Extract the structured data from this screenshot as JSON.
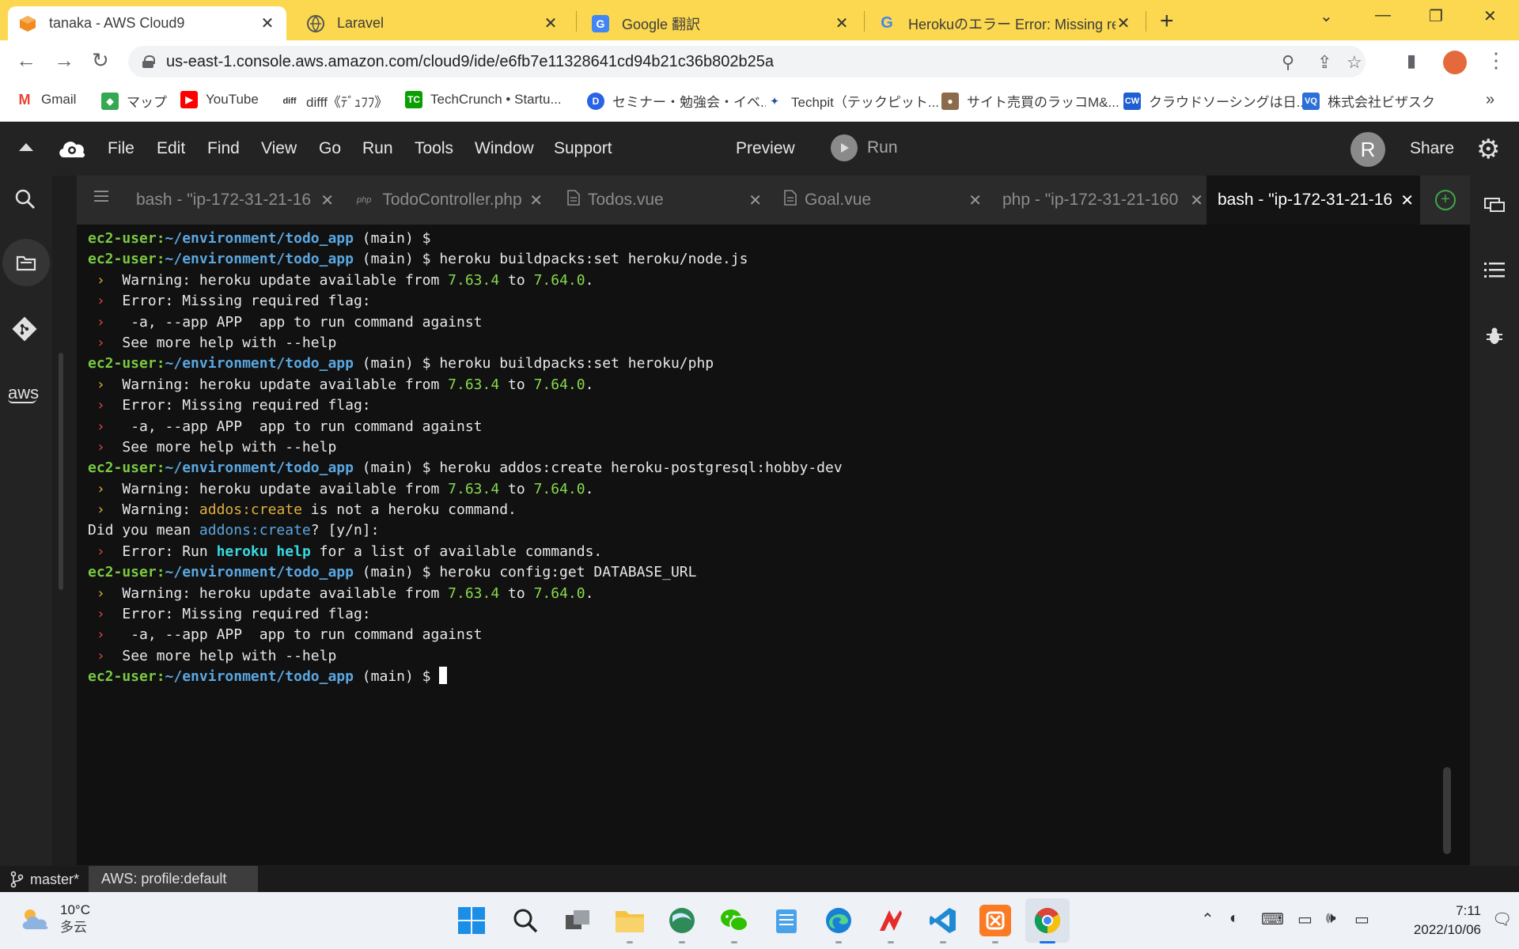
{
  "browser": {
    "tabs": [
      {
        "title": "tanaka - AWS Cloud9"
      },
      {
        "title": "Laravel"
      },
      {
        "title": "Google 翻訳"
      },
      {
        "title": "Herokuのエラー Error: Missing requ"
      }
    ],
    "address": "us-east-1.console.aws.amazon.com/cloud9/ide/e6fb7e11328641cd94b21c36b802b25a",
    "bookmarks": [
      {
        "label": "Gmail"
      },
      {
        "label": "マップ"
      },
      {
        "label": "YouTube"
      },
      {
        "label": "difff《ﾃﾞｭﾌﾌ》"
      },
      {
        "label": "TechCrunch • Startu..."
      },
      {
        "label": "セミナー・勉強会・イベ..."
      },
      {
        "label": "Techpit（テックピット..."
      },
      {
        "label": "サイト売買のラッコM&..."
      },
      {
        "label": "クラウドソーシングは日..."
      },
      {
        "label": "株式会社ビザスク"
      }
    ],
    "more_bookmarks": "»"
  },
  "ide": {
    "menu": [
      "File",
      "Edit",
      "Find",
      "View",
      "Go",
      "Run",
      "Tools",
      "Window",
      "Support"
    ],
    "preview_label": "Preview",
    "run_label": "Run",
    "avatar_letter": "R",
    "share_label": "Share",
    "aws_label": "aws",
    "tabs": [
      {
        "label": "bash - \"ip-172-31-21-16"
      },
      {
        "label": "TodoController.php"
      },
      {
        "label": "Todos.vue"
      },
      {
        "label": "Goal.vue"
      },
      {
        "label": "php - \"ip-172-31-21-160"
      },
      {
        "label": "bash - \"ip-172-31-21-16"
      }
    ],
    "terminal": {
      "prompt_user": "ec2-user:",
      "prompt_path": "~/environment/todo_app",
      "prompt_branch": " (main) $ ",
      "commands": [
        "heroku buildpacks:set heroku/node.js",
        "heroku buildpacks:set heroku/php",
        "heroku addos:create heroku-postgresql:hobby-dev",
        "heroku config:get DATABASE_URL"
      ],
      "arrow": "›",
      "warn_prefix": "  Warning: heroku update available from ",
      "ver_from": "7.63.4",
      "to_word": " to ",
      "ver_to": "7.64.0",
      "period": ".",
      "missing_flag": "  Error: Missing required flag:",
      "app_flag": "   -a, --app APP  app to run command against",
      "more_help": "  See more help with --help",
      "warn2_prefix": "  Warning: ",
      "bad_cmd": "addos:create",
      "not_heroku": " is not a heroku command.",
      "did_you_mean": "Did you mean ",
      "suggestion": "addons:create",
      "yn": "? [y/n]:",
      "run_prefix": "  Error: Run ",
      "help_cmd": "heroku help",
      "run_suffix": " for a list of available commands."
    },
    "status": {
      "branch": "master*",
      "profile": "AWS: profile:default"
    }
  },
  "taskbar": {
    "temperature": "10°C",
    "weather": "多云",
    "time": "7:11",
    "date": "2022/10/06"
  },
  "colors": {
    "chrome_tab_bar": "#fbd84f",
    "ide_bg": "#232323",
    "terminal_bg": "#111111",
    "prompt_green": "#7ac943",
    "prompt_blue": "#5aa7e0",
    "version_green": "#87d94c",
    "arrow_red": "#d9474a",
    "arrow_yellow": "#e0b13a"
  }
}
